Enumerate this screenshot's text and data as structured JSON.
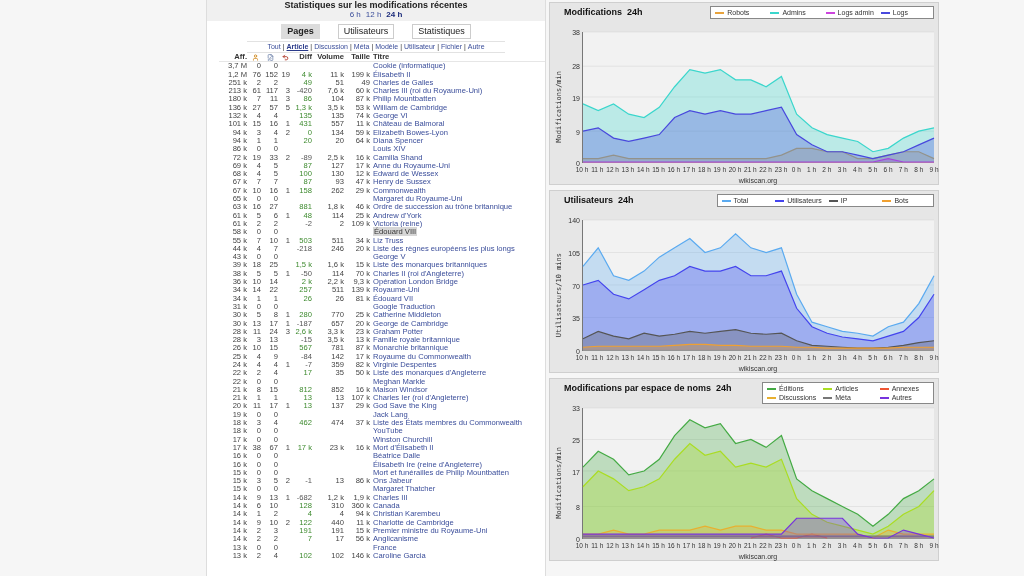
{
  "header": {
    "title": "Statistiques sur les modifications récentes",
    "periods": [
      {
        "label": "6 h",
        "selected": false
      },
      {
        "label": "12 h",
        "selected": false
      },
      {
        "label": "24 h",
        "selected": true
      }
    ]
  },
  "tabs": [
    {
      "label": "Pages",
      "selected": true
    },
    {
      "label": "Utilisateurs",
      "selected": false
    },
    {
      "label": "Statistiques",
      "selected": false
    }
  ],
  "filters": [
    {
      "label": "Tout",
      "selected": false
    },
    {
      "label": "Article",
      "selected": true
    },
    {
      "label": "Discussion",
      "selected": false
    },
    {
      "label": "Méta",
      "selected": false
    },
    {
      "label": "Modèle",
      "selected": false
    },
    {
      "label": "Utilisateur",
      "selected": false
    },
    {
      "label": "Fichier",
      "selected": false
    },
    {
      "label": "Autre",
      "selected": false
    }
  ],
  "separator": "|",
  "table": {
    "columns": [
      {
        "kind": "text",
        "label": "Aff."
      },
      {
        "kind": "icon"
      },
      {
        "kind": "icon"
      },
      {
        "kind": "icon"
      },
      {
        "kind": "text",
        "label": "Diff"
      },
      {
        "kind": "text",
        "label": "Volume"
      },
      {
        "kind": "text",
        "label": "Taille"
      },
      {
        "kind": "text",
        "label": "Titre"
      }
    ],
    "rows": [
      {
        "aff": "3,7 M",
        "users": "0",
        "edits": "0",
        "title": "Cookie (informatique)",
        "kind": "none"
      },
      {
        "aff": "1,2 M",
        "users": "76",
        "edits": "152",
        "reverts": "19",
        "diff": "4 k",
        "volume": "11 k",
        "size": "199 k",
        "title": "Élisabeth II",
        "kind": "gain"
      },
      {
        "aff": "251 k",
        "users": "2",
        "edits": "2",
        "diff": "49",
        "volume": "51",
        "size": "49",
        "title": "Charles de Galles",
        "kind": "gain"
      },
      {
        "aff": "213 k",
        "users": "61",
        "edits": "117",
        "reverts": "3",
        "diff": "-420",
        "volume": "7,6 k",
        "size": "60 k",
        "title": "Charles III (roi du Royaume-Uni)",
        "kind": "loss"
      },
      {
        "aff": "180 k",
        "users": "7",
        "edits": "11",
        "reverts": "3",
        "diff": "86",
        "volume": "104",
        "size": "87 k",
        "title": "Philip Mountbatten",
        "kind": "gain"
      },
      {
        "aff": "136 k",
        "users": "27",
        "edits": "57",
        "reverts": "5",
        "diff": "1,3 k",
        "volume": "3,5 k",
        "size": "53 k",
        "title": "William de Cambridge",
        "kind": "gain"
      },
      {
        "aff": "132 k",
        "users": "4",
        "edits": "4",
        "diff": "135",
        "volume": "135",
        "size": "74 k",
        "title": "George VI",
        "kind": "gain"
      },
      {
        "aff": "101 k",
        "users": "15",
        "edits": "16",
        "reverts": "1",
        "diff": "431",
        "volume": "557",
        "size": "11 k",
        "title": "Château de Balmoral",
        "kind": "gain"
      },
      {
        "aff": "94 k",
        "users": "3",
        "edits": "4",
        "reverts": "2",
        "diff": "0",
        "volume": "134",
        "size": "59 k",
        "title": "Elizabeth Bowes-Lyon",
        "kind": "gain"
      },
      {
        "aff": "94 k",
        "users": "1",
        "edits": "1",
        "diff": "20",
        "volume": "20",
        "size": "64 k",
        "title": "Diana Spencer",
        "kind": "gain"
      },
      {
        "aff": "86 k",
        "users": "0",
        "edits": "0",
        "title": "Louis XIV",
        "kind": "none"
      },
      {
        "aff": "72 k",
        "users": "19",
        "edits": "33",
        "reverts": "2",
        "diff": "-89",
        "volume": "2,5 k",
        "size": "16 k",
        "title": "Camilla Shand",
        "kind": "loss"
      },
      {
        "aff": "69 k",
        "users": "4",
        "edits": "5",
        "diff": "87",
        "volume": "127",
        "size": "17 k",
        "title": "Anne du Royaume-Uni",
        "kind": "gain"
      },
      {
        "aff": "68 k",
        "users": "4",
        "edits": "5",
        "diff": "100",
        "volume": "130",
        "size": "12 k",
        "title": "Edward de Wessex",
        "kind": "gain"
      },
      {
        "aff": "67 k",
        "users": "7",
        "edits": "7",
        "diff": "87",
        "volume": "93",
        "size": "47 k",
        "title": "Henry de Sussex",
        "kind": "gain"
      },
      {
        "aff": "67 k",
        "users": "10",
        "edits": "16",
        "reverts": "1",
        "diff": "158",
        "volume": "262",
        "size": "29 k",
        "title": "Commonwealth",
        "kind": "gain"
      },
      {
        "aff": "65 k",
        "users": "0",
        "edits": "0",
        "title": "Margaret du Royaume-Uni",
        "kind": "none"
      },
      {
        "aff": "63 k",
        "users": "16",
        "edits": "27",
        "diff": "881",
        "volume": "1,8 k",
        "size": "46 k",
        "title": "Ordre de succession au trône britannique",
        "kind": "gain"
      },
      {
        "aff": "61 k",
        "users": "5",
        "edits": "6",
        "reverts": "1",
        "diff": "48",
        "volume": "114",
        "size": "25 k",
        "title": "Andrew d'York",
        "kind": "gain"
      },
      {
        "aff": "61 k",
        "users": "2",
        "edits": "2",
        "diff": "-2",
        "volume": "2",
        "size": "109 k",
        "title": "Victoria (reine)",
        "kind": "loss"
      },
      {
        "aff": "58 k",
        "users": "0",
        "edits": "0",
        "title": "Édouard VIII",
        "kind": "greyed"
      },
      {
        "aff": "55 k",
        "users": "7",
        "edits": "10",
        "reverts": "1",
        "diff": "503",
        "volume": "511",
        "size": "34 k",
        "title": "Liz Truss",
        "kind": "gain"
      },
      {
        "aff": "44 k",
        "users": "4",
        "edits": "7",
        "diff": "-218",
        "volume": "246",
        "size": "20 k",
        "title": "Liste des règnes européens les plus longs",
        "kind": "loss"
      },
      {
        "aff": "43 k",
        "users": "0",
        "edits": "0",
        "title": "George V",
        "kind": "none"
      },
      {
        "aff": "39 k",
        "users": "18",
        "edits": "25",
        "diff": "1,5 k",
        "volume": "1,6 k",
        "size": "15 k",
        "title": "Liste des monarques britanniques",
        "kind": "gain"
      },
      {
        "aff": "38 k",
        "users": "5",
        "edits": "5",
        "reverts": "1",
        "diff": "-50",
        "volume": "114",
        "size": "70 k",
        "title": "Charles II (roi d'Angleterre)",
        "kind": "loss"
      },
      {
        "aff": "36 k",
        "users": "10",
        "edits": "14",
        "diff": "2 k",
        "volume": "2,2 k",
        "size": "9,3 k",
        "title": "Opération London Bridge",
        "kind": "gain"
      },
      {
        "aff": "34 k",
        "users": "14",
        "edits": "22",
        "diff": "257",
        "volume": "511",
        "size": "139 k",
        "title": "Royaume-Uni",
        "kind": "gain"
      },
      {
        "aff": "34 k",
        "users": "1",
        "edits": "1",
        "diff": "26",
        "volume": "26",
        "size": "81 k",
        "title": "Édouard VII",
        "kind": "gain"
      },
      {
        "aff": "31 k",
        "users": "0",
        "edits": "0",
        "title": "Google Traduction",
        "kind": "none"
      },
      {
        "aff": "30 k",
        "users": "5",
        "edits": "8",
        "reverts": "1",
        "diff": "280",
        "volume": "770",
        "size": "25 k",
        "title": "Catherine Middleton",
        "kind": "gain"
      },
      {
        "aff": "30 k",
        "users": "13",
        "edits": "17",
        "reverts": "1",
        "diff": "-187",
        "volume": "657",
        "size": "20 k",
        "title": "George de Cambridge",
        "kind": "loss"
      },
      {
        "aff": "28 k",
        "users": "11",
        "edits": "24",
        "reverts": "3",
        "diff": "2,6 k",
        "volume": "3,3 k",
        "size": "23 k",
        "title": "Graham Potter",
        "kind": "gain"
      },
      {
        "aff": "28 k",
        "users": "3",
        "edits": "13",
        "diff": "-15",
        "volume": "3,5 k",
        "size": "13 k",
        "title": "Famille royale britannique",
        "kind": "loss"
      },
      {
        "aff": "26 k",
        "users": "10",
        "edits": "15",
        "diff": "567",
        "volume": "781",
        "size": "87 k",
        "title": "Monarchie britannique",
        "kind": "gain"
      },
      {
        "aff": "25 k",
        "users": "4",
        "edits": "9",
        "diff": "-84",
        "volume": "142",
        "size": "17 k",
        "title": "Royaume du Commonwealth",
        "kind": "loss"
      },
      {
        "aff": "24 k",
        "users": "4",
        "edits": "4",
        "reverts": "1",
        "diff": "-7",
        "volume": "359",
        "size": "82 k",
        "title": "Virginie Despentes",
        "kind": "loss"
      },
      {
        "aff": "22 k",
        "users": "2",
        "edits": "4",
        "diff": "17",
        "volume": "35",
        "size": "50 k",
        "title": "Liste des monarques d'Angleterre",
        "kind": "gain"
      },
      {
        "aff": "22 k",
        "users": "0",
        "edits": "0",
        "title": "Meghan Markle",
        "kind": "none"
      },
      {
        "aff": "21 k",
        "users": "8",
        "edits": "15",
        "diff": "812",
        "volume": "852",
        "size": "16 k",
        "title": "Maison Windsor",
        "kind": "gain"
      },
      {
        "aff": "21 k",
        "users": "1",
        "edits": "1",
        "diff": "13",
        "volume": "13",
        "size": "107 k",
        "title": "Charles Ier (roi d'Angleterre)",
        "kind": "gain"
      },
      {
        "aff": "20 k",
        "users": "11",
        "edits": "17",
        "reverts": "1",
        "diff": "13",
        "volume": "137",
        "size": "29 k",
        "title": "God Save the King",
        "kind": "gain"
      },
      {
        "aff": "19 k",
        "users": "0",
        "edits": "0",
        "title": "Jack Lang",
        "kind": "none"
      },
      {
        "aff": "18 k",
        "users": "3",
        "edits": "4",
        "diff": "462",
        "volume": "474",
        "size": "37 k",
        "title": "Liste des États membres du Commonwealth",
        "kind": "gain"
      },
      {
        "aff": "18 k",
        "users": "0",
        "edits": "0",
        "title": "YouTube",
        "kind": "none"
      },
      {
        "aff": "17 k",
        "users": "0",
        "edits": "0",
        "title": "Winston Churchill",
        "kind": "none"
      },
      {
        "aff": "17 k",
        "users": "38",
        "edits": "67",
        "reverts": "1",
        "diff": "17 k",
        "volume": "23 k",
        "size": "16 k",
        "title": "Mort d'Élisabeth II",
        "kind": "gain"
      },
      {
        "aff": "16 k",
        "users": "0",
        "edits": "0",
        "title": "Béatrice Dalle",
        "kind": "none"
      },
      {
        "aff": "16 k",
        "users": "0",
        "edits": "0",
        "title": "Élisabeth Ire (reine d'Angleterre)",
        "kind": "none"
      },
      {
        "aff": "15 k",
        "users": "0",
        "edits": "0",
        "title": "Mort et funérailles de Philip Mountbatten",
        "kind": "none"
      },
      {
        "aff": "15 k",
        "users": "3",
        "edits": "5",
        "reverts": "2",
        "diff": "-1",
        "volume": "13",
        "size": "86 k",
        "title": "Ons Jabeur",
        "kind": "loss"
      },
      {
        "aff": "15 k",
        "users": "0",
        "edits": "0",
        "title": "Margaret Thatcher",
        "kind": "none"
      },
      {
        "aff": "14 k",
        "users": "9",
        "edits": "13",
        "reverts": "1",
        "diff": "-682",
        "volume": "1,2 k",
        "size": "1,9 k",
        "title": "Charles III",
        "kind": "loss"
      },
      {
        "aff": "14 k",
        "users": "6",
        "edits": "10",
        "diff": "128",
        "volume": "310",
        "size": "360 k",
        "title": "Canada",
        "kind": "gain"
      },
      {
        "aff": "14 k",
        "users": "1",
        "edits": "2",
        "diff": "4",
        "volume": "4",
        "size": "94 k",
        "title": "Christian Karembeu",
        "kind": "gain"
      },
      {
        "aff": "14 k",
        "users": "9",
        "edits": "10",
        "reverts": "2",
        "diff": "122",
        "volume": "440",
        "size": "11 k",
        "title": "Charlotte de Cambridge",
        "kind": "gain"
      },
      {
        "aff": "14 k",
        "users": "2",
        "edits": "3",
        "diff": "191",
        "volume": "191",
        "size": "15 k",
        "title": "Premier ministre du Royaume-Uni",
        "kind": "gain"
      },
      {
        "aff": "14 k",
        "users": "2",
        "edits": "2",
        "diff": "7",
        "volume": "17",
        "size": "56 k",
        "title": "Anglicanisme",
        "kind": "gain"
      },
      {
        "aff": "13 k",
        "users": "0",
        "edits": "0",
        "title": "France",
        "kind": "none"
      },
      {
        "aff": "13 k",
        "users": "2",
        "edits": "4",
        "diff": "102",
        "volume": "102",
        "size": "146 k",
        "title": "Caroline Garcia",
        "kind": "gain"
      }
    ]
  },
  "charts": [
    {
      "chart_data": {
        "type": "area",
        "title": "Modifications  24h",
        "ylabel": "Modifications/min",
        "xlabel": "wikiscan.org",
        "categories": [
          "10 h",
          "11 h",
          "12 h",
          "13 h",
          "14 h",
          "15 h",
          "16 h",
          "17 h",
          "18 h",
          "19 h",
          "20 h",
          "21 h",
          "22 h",
          "23 h",
          "0 h",
          "1 h",
          "2 h",
          "3 h",
          "4 h",
          "5 h",
          "6 h",
          "7 h",
          "8 h",
          "9 h"
        ],
        "grid": true,
        "legend": "upper right",
        "ylim": [
          0,
          38
        ],
        "yticks": [
          0,
          9,
          19,
          28,
          38
        ],
        "series": [
          {
            "name": "Robots",
            "color": "#e8a33c",
            "values": [
              1,
              1,
              2,
              1,
              1,
              1,
              1,
              1,
              1,
              1,
              1,
              1,
              1,
              2,
              4,
              4,
              3,
              3,
              1,
              1,
              2,
              3,
              3,
              1
            ]
          },
          {
            "name": "Admins",
            "color": "#3ad6cc",
            "values": [
              17,
              15,
              17,
              14,
              13,
              16,
              22,
              27,
              26,
              27,
              24,
              24,
              22,
              25,
              14,
              10,
              8,
              7,
              6,
              3,
              4,
              7,
              9,
              10
            ]
          },
          {
            "name": "Logs admin",
            "color": "#cc44dd",
            "values": [
              0,
              0,
              0,
              0,
              0,
              0,
              0,
              0,
              0,
              0,
              0,
              0,
              0,
              0,
              0,
              0,
              0,
              0,
              0,
              0,
              1,
              0,
              0,
              0
            ]
          },
          {
            "name": "Logs",
            "color": "#4848dd",
            "values": [
              9,
              10,
              7,
              6,
              7,
              8,
              13,
              15,
              14,
              15,
              14,
              14,
              15,
              16,
              8,
              5,
              3,
              3,
              2,
              1,
              2,
              3,
              5,
              7
            ]
          }
        ]
      }
    },
    {
      "chart_data": {
        "type": "area",
        "title": "Utilisateurs  24h",
        "ylabel": "Utilisateurs/10 mins",
        "xlabel": "wikiscan.org",
        "categories": [
          "10 h",
          "11 h",
          "12 h",
          "13 h",
          "14 h",
          "15 h",
          "16 h",
          "17 h",
          "18 h",
          "19 h",
          "20 h",
          "21 h",
          "22 h",
          "23 h",
          "0 h",
          "1 h",
          "2 h",
          "3 h",
          "4 h",
          "5 h",
          "6 h",
          "7 h",
          "8 h",
          "9 h"
        ],
        "grid": true,
        "legend": "upper right",
        "ylim": [
          0,
          140
        ],
        "yticks": [
          0,
          35,
          70,
          105,
          140
        ],
        "series": [
          {
            "name": "Total",
            "color": "#5aaaf0",
            "values": [
              90,
              110,
              80,
              75,
              85,
              100,
              110,
              120,
              105,
              110,
              125,
              110,
              105,
              110,
              60,
              30,
              25,
              20,
              18,
              15,
              25,
              30,
              50,
              80
            ]
          },
          {
            "name": "Utilisateurs",
            "color": "#4444ee",
            "values": [
              70,
              75,
              60,
              55,
              65,
              75,
              80,
              90,
              85,
              85,
              90,
              80,
              80,
              85,
              45,
              25,
              18,
              14,
              12,
              10,
              15,
              20,
              35,
              60
            ]
          },
          {
            "name": "IP",
            "color": "#555555",
            "values": [
              12,
              20,
              15,
              12,
              18,
              15,
              17,
              20,
              18,
              20,
              22,
              18,
              17,
              18,
              10,
              5,
              4,
              3,
              2,
              2,
              3,
              5,
              8,
              10
            ]
          },
          {
            "name": "Bots",
            "color": "#f0a030",
            "values": [
              3,
              4,
              4,
              4,
              4,
              4,
              5,
              6,
              6,
              5,
              5,
              4,
              4,
              4,
              3,
              3,
              2,
              2,
              2,
              2,
              2,
              3,
              3,
              3
            ]
          }
        ]
      }
    },
    {
      "chart_data": {
        "type": "area",
        "title": "Modifications par espace de noms  24h",
        "ylabel": "Modifications/min",
        "xlabel": "wikiscan.org",
        "categories": [
          "10 h",
          "11 h",
          "12 h",
          "13 h",
          "14 h",
          "15 h",
          "16 h",
          "17 h",
          "18 h",
          "19 h",
          "20 h",
          "21 h",
          "22 h",
          "23 h",
          "0 h",
          "1 h",
          "2 h",
          "3 h",
          "4 h",
          "5 h",
          "6 h",
          "7 h",
          "8 h",
          "9 h"
        ],
        "grid": true,
        "legend": "upper right",
        "ylim": [
          0,
          33
        ],
        "yticks": [
          0,
          8,
          17,
          25,
          33
        ],
        "series": [
          {
            "name": "Éditions",
            "color": "#44aa44",
            "values": [
              18,
              22,
              20,
              16,
              17,
              20,
              26,
              30,
              28,
              29,
              24,
              25,
              23,
              26,
              15,
              12,
              10,
              8,
              6,
              3,
              6,
              10,
              12,
              15
            ]
          },
          {
            "name": "Articles",
            "color": "#aadd22",
            "values": [
              13,
              17,
              15,
              12,
              13,
              15,
              20,
              24,
              21,
              22,
              18,
              19,
              18,
              20,
              10,
              6,
              4,
              3,
              2,
              1,
              3,
              6,
              8,
              12
            ]
          },
          {
            "name": "Annexes",
            "color": "#ee5533",
            "values": [
              null,
              null,
              null,
              null,
              null,
              null,
              null,
              null,
              null,
              null,
              null,
              0,
              1,
              0,
              0,
              1,
              0,
              null,
              null,
              null,
              null,
              null,
              null,
              null
            ]
          },
          {
            "name": "Discussions",
            "color": "#e8b030",
            "values": [
              1,
              1,
              2,
              1,
              1,
              2,
              2,
              2,
              3,
              2,
              3,
              3,
              2,
              2,
              1,
              1,
              1,
              1,
              1,
              0,
              2,
              1,
              1,
              1
            ]
          },
          {
            "name": "Méta",
            "color": "#777777",
            "values": [
              0.5,
              0.5,
              0.5,
              0.5,
              0.5,
              0.5,
              0.5,
              0.5,
              0.5,
              0.5,
              0.5,
              0.5,
              0.5,
              0.5,
              0.5,
              0.5,
              0.5,
              0.5,
              0.5,
              0.5,
              0.5,
              0.5,
              0.5,
              0.5
            ]
          },
          {
            "name": "Autres",
            "color": "#7733dd",
            "values": [
              1,
              1,
              1,
              1,
              1,
              1,
              1,
              1,
              1,
              1,
              1,
              1,
              1,
              1,
              5,
              5,
              5,
              5,
              1,
              0,
              0,
              2,
              1,
              0
            ]
          }
        ]
      }
    }
  ]
}
